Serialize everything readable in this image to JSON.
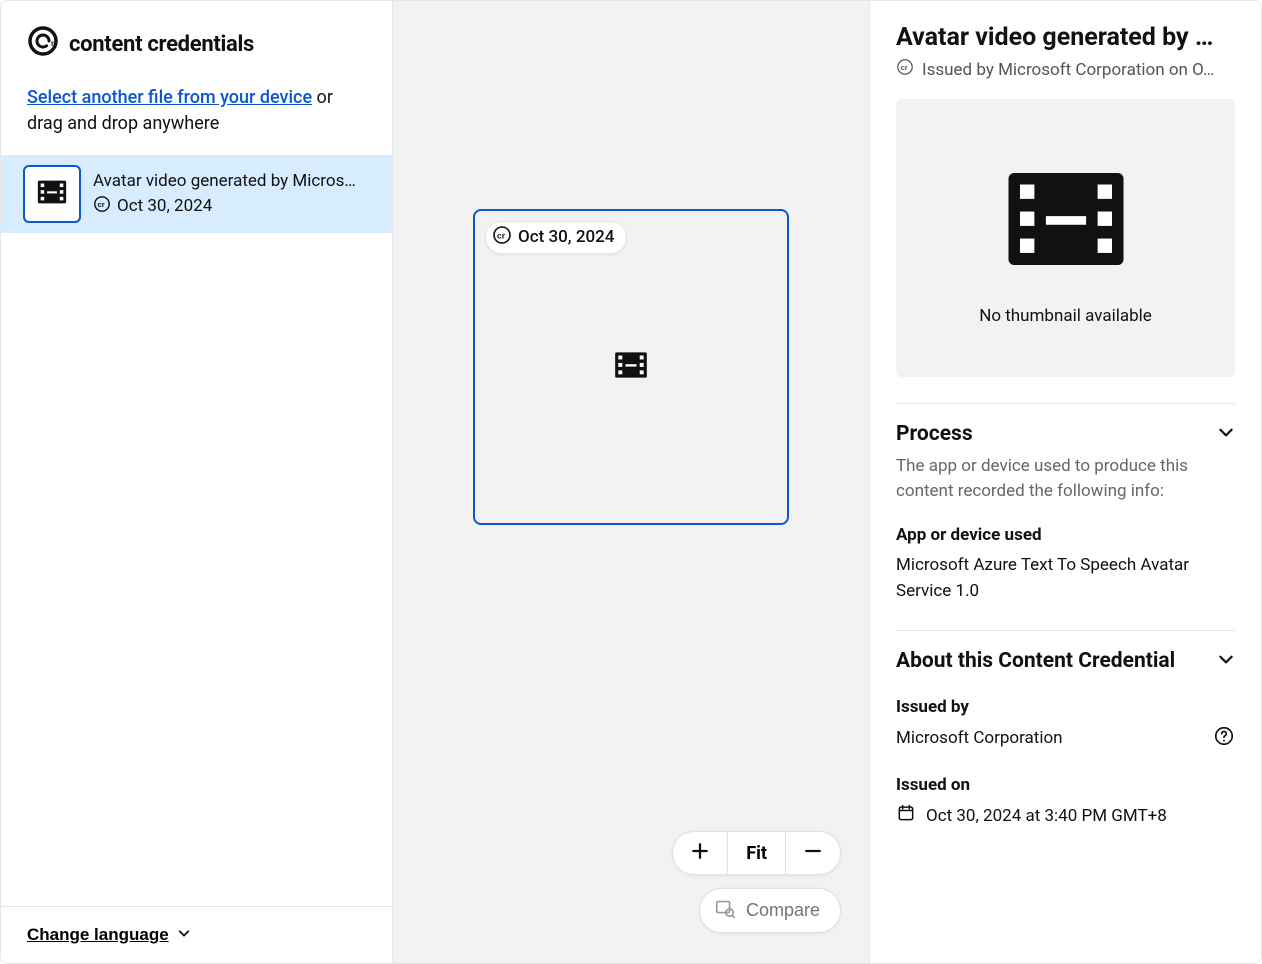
{
  "brand": "content credentials",
  "sidebar": {
    "select_link": "Select another file from your device",
    "drag_suffix": " or drag and drop anywhere",
    "items": [
      {
        "title": "Avatar video generated by Micros…",
        "date": "Oct 30, 2024"
      }
    ],
    "change_language": "Change language"
  },
  "canvas": {
    "badge_date": "Oct 30, 2024",
    "zoom": {
      "fit": "Fit"
    },
    "compare": "Compare"
  },
  "details": {
    "title": "Avatar video generated by Micr…",
    "issuer_line": "Issued by Microsoft Corporation on O…",
    "no_thumb": "No thumbnail available",
    "process": {
      "header": "Process",
      "desc": "The app or device used to produce this content recorded the following info:",
      "app_label": "App or device used",
      "app_value": "Microsoft Azure Text To Speech Avatar Service 1.0"
    },
    "about": {
      "header": "About this Content Credential",
      "issued_by_label": "Issued by",
      "issued_by_value": "Microsoft Corporation",
      "issued_on_label": "Issued on",
      "issued_on_value": "Oct 30, 2024 at 3:40 PM GMT+8"
    }
  }
}
